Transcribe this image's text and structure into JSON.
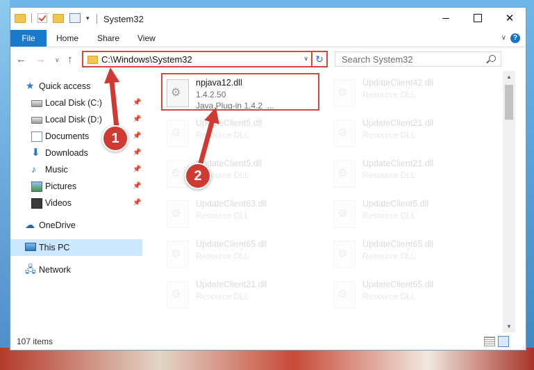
{
  "window": {
    "title": "System32",
    "quick_access_toolbar": [
      "folder-icon",
      "checkmark-icon",
      "folder-icon",
      "properties-icon",
      "chevron-down-icon"
    ]
  },
  "ribbon": {
    "tabs": [
      {
        "label": "File",
        "active": true
      },
      {
        "label": "Home"
      },
      {
        "label": "Share"
      },
      {
        "label": "View"
      }
    ],
    "accent": "#1979ca"
  },
  "address_bar": {
    "path": "C:\\Windows\\System32",
    "highlight_color": "#d9443b"
  },
  "search": {
    "placeholder": "Search System32"
  },
  "nav_pane": {
    "items": [
      {
        "label": "Quick access",
        "icon": "star-icon"
      },
      {
        "label": "Local Disk (C:)",
        "icon": "drive-icon",
        "pinned": true
      },
      {
        "label": "Local Disk (D:)",
        "icon": "drive-icon",
        "pinned": true
      },
      {
        "label": "Documents",
        "icon": "documents-icon",
        "pinned": true
      },
      {
        "label": "Downloads",
        "icon": "download-icon",
        "pinned": true
      },
      {
        "label": "Music",
        "icon": "music-icon",
        "pinned": true
      },
      {
        "label": "Pictures",
        "icon": "pictures-icon",
        "pinned": true
      },
      {
        "label": "Videos",
        "icon": "videos-icon",
        "pinned": true
      },
      {
        "label": "OneDrive",
        "icon": "cloud-icon"
      },
      {
        "label": "This PC",
        "icon": "computer-icon",
        "selected": true
      },
      {
        "label": "Network",
        "icon": "network-icon"
      }
    ]
  },
  "files": [
    {
      "name": "npjava12.dll",
      "line1": "1.4.2.50",
      "line2": "Java Plug-in 1.4.2_...",
      "highlighted": true
    },
    {
      "name": "UpdateClient42.dll",
      "line1": "Resource DLL",
      "faded": true
    },
    {
      "name": "UpdateClient5.dll",
      "line1": "Resource DLL",
      "faded": true
    },
    {
      "name": "UpdateClient21.dll",
      "line1": "Resource DLL",
      "faded": true
    },
    {
      "name": "UpdateClient5.dll",
      "line1": "Resource DLL",
      "faded": true
    },
    {
      "name": "UpdateClient21.dll",
      "line1": "Resource DLL",
      "faded": true
    },
    {
      "name": "UpdateClient63.dll",
      "line1": "Resource DLL",
      "faded": true
    },
    {
      "name": "UpdateClient5.dll",
      "line1": "Resource DLL",
      "faded": true
    },
    {
      "name": "UpdateClient65.dll",
      "line1": "Resource DLL",
      "faded": true
    },
    {
      "name": "UpdateClient65.dll",
      "line1": "Resource DLL",
      "faded": true
    },
    {
      "name": "UpdateClient21.dll",
      "line1": "Resource DLL",
      "faded": true
    },
    {
      "name": "UpdateClient65.dll",
      "line1": "Resource DLL",
      "faded": true
    }
  ],
  "status_bar": {
    "item_count": "107 items"
  },
  "annotations": {
    "step1": "1",
    "step2": "2",
    "color": "#cf3b33"
  }
}
